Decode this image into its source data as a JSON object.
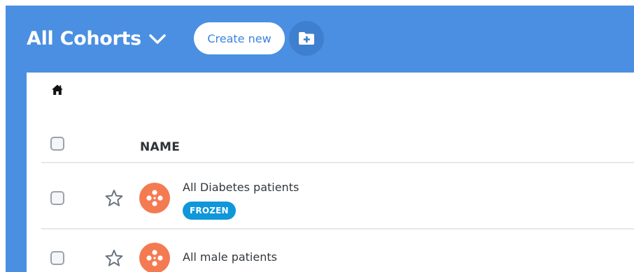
{
  "header": {
    "title": "All Cohorts",
    "dropdown_icon": "chevron-down-icon",
    "create_label": "Create new",
    "new_folder_icon": "folder-plus-icon"
  },
  "breadcrumb": {
    "home_icon": "home-icon"
  },
  "table": {
    "columns": [
      "NAME"
    ],
    "rows": [
      {
        "name": "All Diabetes patients",
        "badge": "FROZEN",
        "icon": "cohort-icon",
        "starred": false
      },
      {
        "name": "All male patients",
        "badge": "",
        "icon": "cohort-icon",
        "starred": false
      }
    ]
  },
  "colors": {
    "header_bg": "#4a8fe2",
    "accent": "#3a84dd",
    "cohort_icon": "#f47a52",
    "badge_bg": "#0f97d9"
  }
}
